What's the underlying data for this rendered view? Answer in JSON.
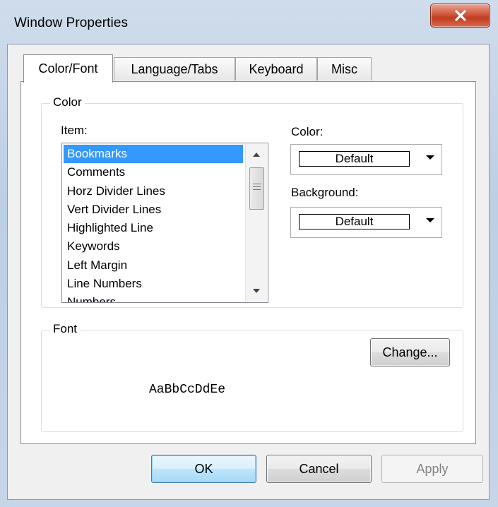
{
  "window": {
    "title": "Window Properties",
    "close_glyph": "x"
  },
  "tabs": [
    {
      "label": "Color/Font",
      "active": true
    },
    {
      "label": "Language/Tabs",
      "active": false
    },
    {
      "label": "Keyboard",
      "active": false
    },
    {
      "label": "Misc",
      "active": false
    }
  ],
  "color_group": {
    "label": "Color",
    "item_label": "Item:",
    "items": [
      "Bookmarks",
      "Comments",
      "Horz Divider Lines",
      "Vert Divider Lines",
      "Highlighted Line",
      "Keywords",
      "Left Margin",
      "Line Numbers",
      "Numbers"
    ],
    "selected_item": "Bookmarks",
    "color_label": "Color:",
    "color_value": "Default",
    "background_label": "Background:",
    "background_value": "Default"
  },
  "font_group": {
    "label": "Font",
    "change_button": "Change...",
    "sample_text": "AaBbCcDdEe"
  },
  "buttons": {
    "ok": "OK",
    "cancel": "Cancel",
    "apply": "Apply"
  },
  "colors": {
    "selection": "#3399ff",
    "close_button": "#c13b1f",
    "default_button_border": "#3c7fb1"
  },
  "icons": {
    "close": "close-icon",
    "scroll_up": "scroll-up-arrow-icon",
    "scroll_down": "scroll-down-arrow-icon",
    "dropdown": "chevron-down-icon"
  }
}
